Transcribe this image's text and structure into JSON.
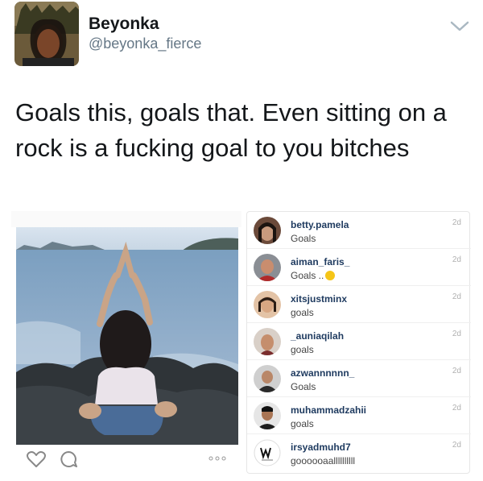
{
  "author": {
    "display_name": "Beyonka",
    "handle": "@beyonka_fierce"
  },
  "tweet": {
    "text": "Goals this, goals that. Even sitting on a rock is a fucking goal to you bitches"
  },
  "instagram_post": {
    "comments": [
      {
        "user": "betty.pamela",
        "text": "Goals",
        "time": "2d"
      },
      {
        "user": "aiman_faris_",
        "text": "Goals ..",
        "time": "2d",
        "has_emoji": true
      },
      {
        "user": "xitsjustminx",
        "text": "goals",
        "time": "2d"
      },
      {
        "user": "_auniaqilah",
        "text": "goals",
        "time": "2d"
      },
      {
        "user": "azwannnnnn_",
        "text": "Goals",
        "time": "2d"
      },
      {
        "user": "muhammadzahii",
        "text": "goals",
        "time": "2d"
      },
      {
        "user": "irsyadmuhd7",
        "text": "goooooaallllllllll",
        "time": "2d"
      }
    ]
  },
  "colors": {
    "text_primary": "#14171a",
    "text_secondary": "#657786",
    "comment_user": "#1e3a5f"
  }
}
